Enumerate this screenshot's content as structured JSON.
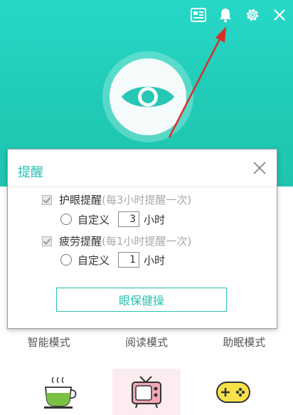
{
  "header": {
    "icons": [
      "news-icon",
      "bell-icon",
      "gear-icon",
      "close-icon"
    ]
  },
  "popup": {
    "title": "提醒",
    "reminders": [
      {
        "label": "护眼提醒",
        "hint": "(每3小时提醒一次)",
        "custom_label": "自定义",
        "value": "3",
        "unit": "小时"
      },
      {
        "label": "疲劳提醒",
        "hint": "(每1小时提醒一次)",
        "custom_label": "自定义",
        "value": "1",
        "unit": "小时"
      }
    ],
    "button": "眼保健操"
  },
  "modes": [
    "智能模式",
    "阅读模式",
    "助眠模式"
  ],
  "colors": {
    "accent": "#2cc0b1",
    "header": "#20cbb6",
    "arrow": "#d9302a"
  }
}
